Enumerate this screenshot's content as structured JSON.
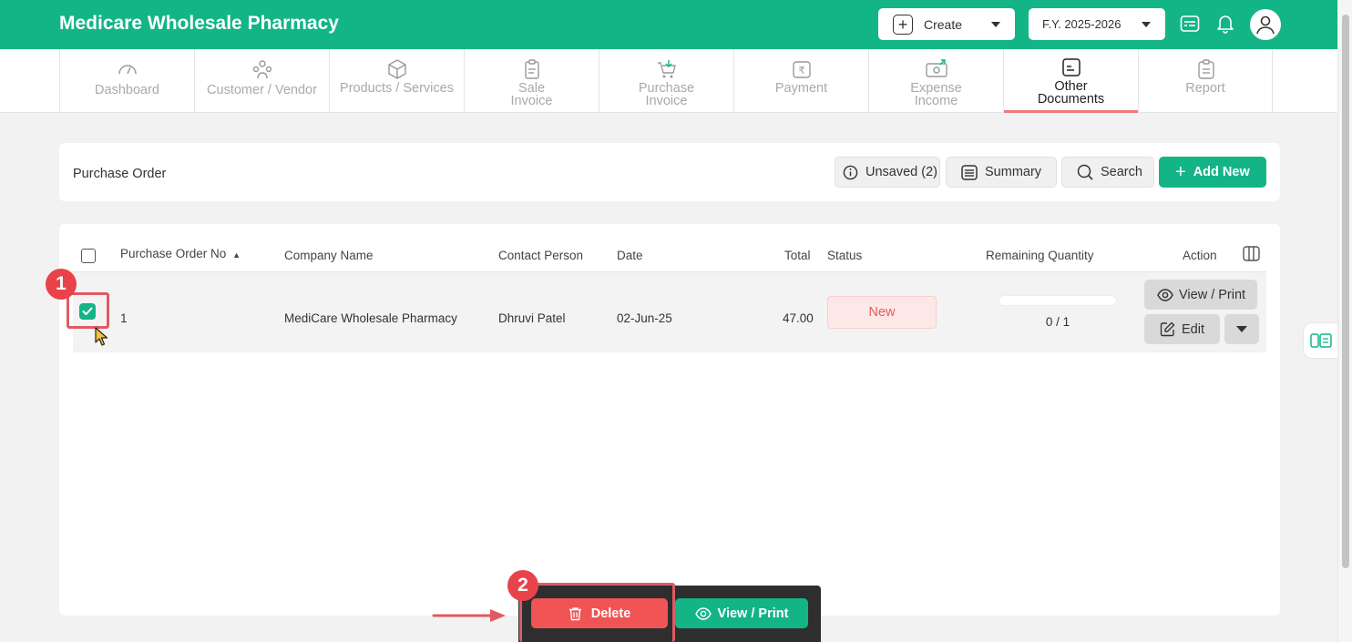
{
  "header": {
    "brand": "Medicare Wholesale Pharmacy",
    "create_label": "Create",
    "fy_label": "F.Y. 2025-2026"
  },
  "tabs": [
    {
      "label": "Dashboard",
      "icon": "gauge-icon"
    },
    {
      "label": "Customer / Vendor",
      "icon": "users-icon"
    },
    {
      "label": "Products / Services",
      "icon": "box-icon"
    },
    {
      "label_line1": "Sale",
      "label_line2": "Invoice",
      "icon": "clipboard-icon"
    },
    {
      "label_line1": "Purchase",
      "label_line2": "Invoice",
      "icon": "cart-icon"
    },
    {
      "label": "Payment",
      "icon": "rupee-note-icon"
    },
    {
      "label_line1": "Expense",
      "label_line2": "Income",
      "icon": "expense-icon"
    },
    {
      "label_line1": "Other",
      "label_line2": "Documents",
      "icon": "document-icon",
      "active": true
    },
    {
      "label": "Report",
      "icon": "report-icon"
    }
  ],
  "toolbar": {
    "title": "Purchase Order",
    "unsaved_label": "Unsaved (2)",
    "summary_label": "Summary",
    "search_label": "Search",
    "add_new_label": "Add New"
  },
  "table": {
    "columns": {
      "po_no": "Purchase Order No",
      "company": "Company Name",
      "contact": "Contact Person",
      "date": "Date",
      "total": "Total",
      "status": "Status",
      "remaining": "Remaining Quantity",
      "action": "Action"
    },
    "rows": [
      {
        "po_no": "1",
        "company": "MediCare Wholesale Pharmacy",
        "contact": "Dhruvi Patel",
        "date": "02-Jun-25",
        "total": "47.00",
        "status": "New",
        "remaining": "0 / 1",
        "remaining_fraction": 0,
        "selected": true,
        "view_print_label": "View / Print",
        "edit_label": "Edit"
      }
    ]
  },
  "bulk_actions": {
    "delete_label": "Delete",
    "view_print_label": "View / Print"
  },
  "annotations": {
    "step1": "1",
    "step2": "2"
  },
  "colors": {
    "brand": "#13b586",
    "danger": "#f05454",
    "annotation": "#e8434a"
  }
}
